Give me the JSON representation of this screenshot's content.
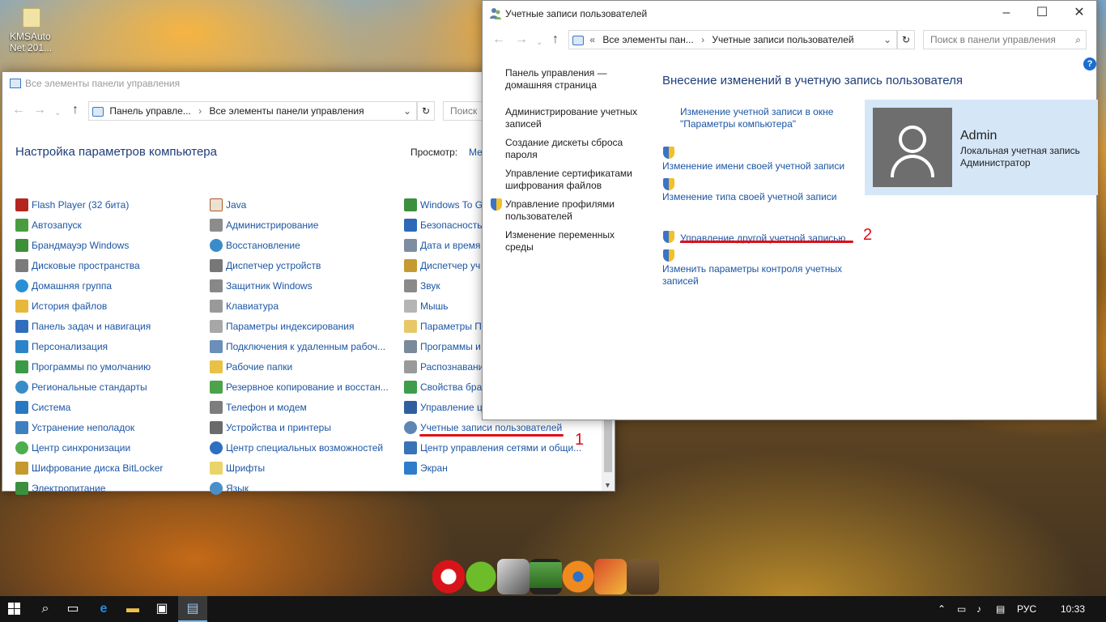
{
  "desktop": {
    "icon_label": "KMSAuto Net 201..."
  },
  "cp_window": {
    "title": "Все элементы панели управления",
    "address": [
      "Панель управле...",
      "Все элементы панели управления"
    ],
    "search_placeholder": "Поиск",
    "heading": "Настройка параметров компьютера",
    "view_label": "Просмотр:",
    "view_value": "Ме",
    "col1": [
      "Flash Player (32 бита)",
      "Автозапуск",
      "Брандмауэр Windows",
      "Дисковые пространства",
      "Домашняя группа",
      "История файлов",
      "Панель задач и навигация",
      "Персонализация",
      "Программы по умолчанию",
      "Региональные стандарты",
      "Система",
      "Устранение неполадок",
      "Центр синхронизации",
      "Шифрование диска BitLocker",
      "Электропитание"
    ],
    "col2": [
      "Java",
      "Администрирование",
      "Восстановление",
      "Диспетчер устройств",
      "Защитник Windows",
      "Клавиатура",
      "Параметры индексирования",
      "Подключения к удаленным рабоч...",
      "Рабочие папки",
      "Резервное копирование и восстан...",
      "Телефон и модем",
      "Устройства и принтеры",
      "Центр специальных возможностей",
      "Шрифты",
      "Язык"
    ],
    "col3": [
      "Windows To G",
      "Безопасность",
      "Дата и время",
      "Диспетчер уч",
      "Звук",
      "Мышь",
      "Параметры П",
      "Программы и",
      "Распознавани",
      "Свойства бра",
      "Управление ц",
      "Учетные записи пользователей",
      "Центр управления сетями и общи...",
      "Экран"
    ]
  },
  "ua_window": {
    "title": "Учетные записи пользователей",
    "address": [
      "Все элементы пан...",
      "Учетные записи пользователей"
    ],
    "search_placeholder": "Поиск в панели управления",
    "sidebar": [
      "Панель управления — домашняя страница",
      "Администрирование учетных записей",
      "Создание дискеты сброса пароля",
      "Управление сертификатами шифрования файлов",
      "Управление профилями пользователей",
      "Изменение переменных среды"
    ],
    "main_title": "Внесение изменений в учетную запись пользователя",
    "tasks": {
      "change_in_settings": "Изменение учетной записи в окне \"Параметры компьютера\"",
      "change_name": "Изменение имени своей учетной записи",
      "change_type": "Изменение типа своей учетной записи",
      "manage_other": "Управление другой учетной записью",
      "uac": "Изменить параметры контроля учетных записей"
    },
    "user": {
      "name": "Admin",
      "line1": "Локальная учетная запись",
      "line2": "Администратор"
    },
    "help": "?"
  },
  "annotations": {
    "one": "1",
    "two": "2"
  },
  "taskbar": {
    "lang": "РУС",
    "time": "10:33"
  }
}
